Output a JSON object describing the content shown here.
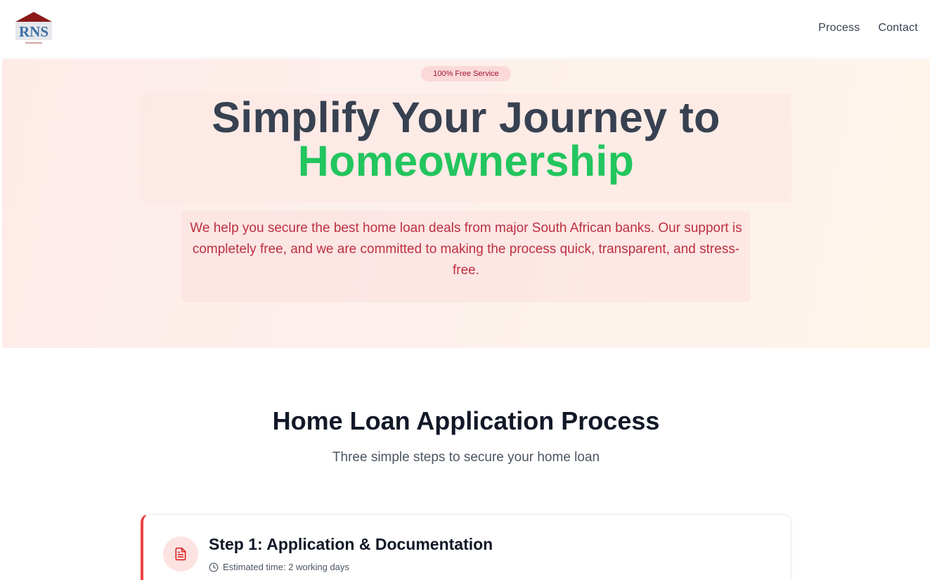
{
  "header": {
    "logo_text": "RNS",
    "nav": [
      {
        "label": "Process"
      },
      {
        "label": "Contact"
      }
    ]
  },
  "hero": {
    "badge": "100% Free Service",
    "title_line1": "Simplify Your Journey to",
    "title_accent": "Homeownership",
    "description": "We help you secure the best home loan deals from major South African banks. Our support is completely free, and we are committed to making the process quick, transparent, and stress-free."
  },
  "process": {
    "title": "Home Loan Application Process",
    "subtitle": "Three simple steps to secure your home loan",
    "steps": [
      {
        "title": "Step 1: Application & Documentation",
        "time": "Estimated time: 2 working days",
        "icon": "document-icon"
      }
    ]
  },
  "colors": {
    "accent_green": "#22c55e",
    "accent_red": "#ef4444",
    "hero_text_red": "#be2f3f",
    "logo_red": "#8b1a1a",
    "logo_blue": "#3b6ea5"
  }
}
